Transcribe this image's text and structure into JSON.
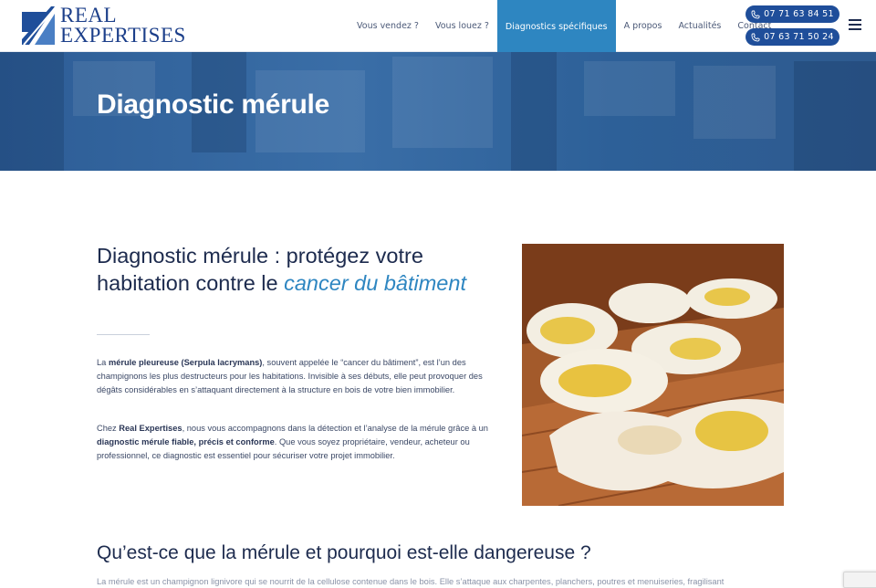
{
  "header": {
    "logo_text_line1": "REAL",
    "logo_text_line2": "EXPERTISES",
    "nav": [
      {
        "label": "Vous vendez ?"
      },
      {
        "label": "Vous louez ?"
      },
      {
        "label": "Diagnostics spécifiques",
        "active": true
      },
      {
        "label": "A propos"
      },
      {
        "label": "Actualités"
      },
      {
        "label": "Contact"
      }
    ],
    "phones": [
      "07 71 63 84 51",
      "07 63 71 50 24"
    ],
    "accent_color": "#2e86c1",
    "brand_color": "#1f4e9a"
  },
  "hero": {
    "title": "Diagnostic mérule"
  },
  "intro": {
    "heading_main": "Diagnostic mérule : protégez votre habitation contre le ",
    "heading_em": "cancer du bâtiment",
    "p1": [
      {
        "t": "La ",
        "b": false
      },
      {
        "t": "mérule pleureuse (Serpula lacrymans)",
        "b": true
      },
      {
        "t": ", souvent appelée le “cancer du bâtiment”, est l’un des champignons les plus destructeurs pour les habitations. Invisible à ses débuts, elle peut provoquer des dégâts considérables en s’attaquant directement à la structure en bois de votre bien immobilier.",
        "b": false
      }
    ],
    "p2": [
      {
        "t": "Chez ",
        "b": false
      },
      {
        "t": "Real Expertises",
        "b": true
      },
      {
        "t": ", nous vous accompagnons dans la détection et l’analyse de la mérule grâce à un ",
        "b": false
      },
      {
        "t": "diagnostic mérule fiable, précis et conforme",
        "b": true
      },
      {
        "t": ". Que vous soyez propriétaire, vendeur, acheteur ou professionnel, ce diagnostic est essentiel pour sécuriser votre projet immobilier.",
        "b": false
      }
    ]
  },
  "section2": {
    "heading": "Qu’est-ce que la mérule et pourquoi est-elle dangereuse ?",
    "cut_text": "La mérule est un champignon lignivore qui se nourrit de la cellulose contenue dans le bois. Elle s’attaque aux charpentes, planchers, poutres et menuiseries, fragilisant"
  }
}
